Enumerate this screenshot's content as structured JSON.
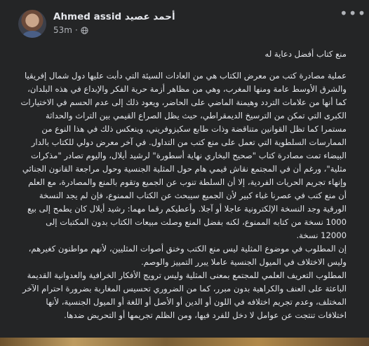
{
  "post": {
    "author_latin": "Ahmed assid",
    "author_arabic": "أحمد عصيد",
    "time": "53m",
    "privacy_icon": "globe-icon",
    "more_icon": "more-options-icon",
    "title": "منع كتاب أفضل دعاية له",
    "paragraphs": [
      "عملية مصادرة كتب من معرض الكتاب هي من العادات السيئة التي دأبت عليها دول شمال إفريقيا والشرق الأوسط عامة ومنها المغرب، وهي من مظاهر أزمة حرية الفكر والإبداع في هذه البلدان، كما أنها من علامات التردد وهيمنة الماضي على الحاضر، ويعود ذلك إلى عدم الحسم في الاختيارات الكبرى التي تمكن من الترسيخ الديمقراطي، حيث يظل الصراع القيمي بين التراث والحداثة مستمرا كما تظل القوانين متناقضة وذات طابع سكيزوفريني، وينعكس ذلك في هذا النوع من الممارسات السلطوية التي تعمل على منع كتب من التداول. في آخر معرض دولي للكتاب بالدار البيضاء تمت مصادرة كتاب \"صحيح البخاري نهاية أسطورة\" لرشيد أيلال، واليوم تصادر \"مذكرات مثلية\"، ورغم أن في المجتمع نقاش قيمي هام حول المثلية الجنسية وحول مراجعة القانون الجنائي وإنهاء تجريم الحريات الفردية، إلا أن السلطة تنوب عن الجميع وتقوم بالمنع والمصادرة، مع العلم أن منع كتب في عصرنا غباء كبير لأن الجميع سيبحث عن الكتاب الممنوع، فإن لم يجد النسخة الورقية وجد النسخة الإلكترونية عاجلا أو آجلا. وأعطيكم رقما مهما: رشيد أيلال كان يطمح إلى بيع 1000 نسخة من كتابه الممنوع، لكنه بفضل المنع وصلت مبيعات الكتاب بدون المكتبات إلى 12000 نسخة.",
      "إن المطلوب في موضوع المثلية ليس منع الكتب وخنق أصوات المثليين، لأنهم مواطنون كغيرهم، وليس الاختلاف في الميول الجنسية عاملا يبرر التمييز والوصم.",
      "المطلوب التعريف العلمي للمجتمع بمعنى المثلية وليس ترويج الأفكار الخرافية والعدوانية القديمة الباعثة على العنف والكراهية بدون مبرر، كما من الضروري تحسيس المغاربة بضرورة احترام الآخر المختلف، وعدم تجريم اختلافه في اللون أو الدين أو الأصل أو اللغة أو الميول الجنسية، لأنها اختلافات تنتجت عن عوامل لا دخل للفرد فيها، ومن الظلم تجريمها أو التحريض ضدها."
    ]
  }
}
